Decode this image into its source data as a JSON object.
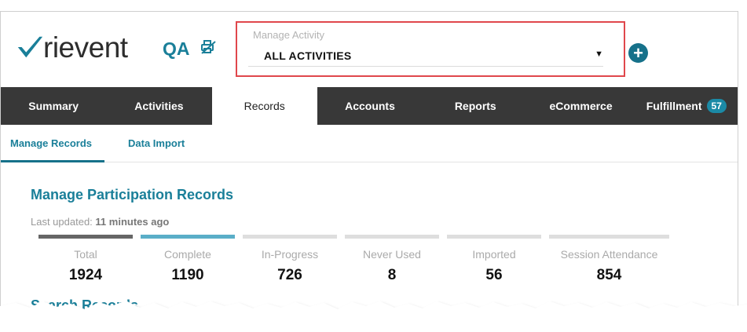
{
  "brand": {
    "logo_text": "rievent",
    "environment": "QA"
  },
  "activity_selector": {
    "label": "Manage Activity",
    "value": "ALL ACTIVITIES"
  },
  "nav": {
    "tabs": [
      {
        "label": "Summary"
      },
      {
        "label": "Activities"
      },
      {
        "label": "Records"
      },
      {
        "label": "Accounts"
      },
      {
        "label": "Reports"
      },
      {
        "label": "eCommerce"
      },
      {
        "label": "Fulfillment",
        "badge": "57"
      }
    ],
    "active": "Records"
  },
  "subnav": {
    "tabs": [
      {
        "label": "Manage Records"
      },
      {
        "label": "Data Import"
      }
    ]
  },
  "content": {
    "title": "Manage Participation Records",
    "last_updated_label": "Last updated:",
    "last_updated_value": "11 minutes ago",
    "search_title": "Search Records"
  },
  "stats": [
    {
      "label": "Total",
      "value": "1924",
      "bar_color": "#666666"
    },
    {
      "label": "Complete",
      "value": "1190",
      "bar_color": "#5aaec8"
    },
    {
      "label": "In-Progress",
      "value": "726",
      "bar_color": "#dddddd"
    },
    {
      "label": "Never Used",
      "value": "8",
      "bar_color": "#dddddd"
    },
    {
      "label": "Imported",
      "value": "56",
      "bar_color": "#dddddd"
    },
    {
      "label": "Session Attendance",
      "value": "854",
      "bar_color": "#dddddd"
    }
  ],
  "colors": {
    "accent": "#1a7f99",
    "nav_bg": "#383838",
    "highlight_border": "#e0474c"
  }
}
